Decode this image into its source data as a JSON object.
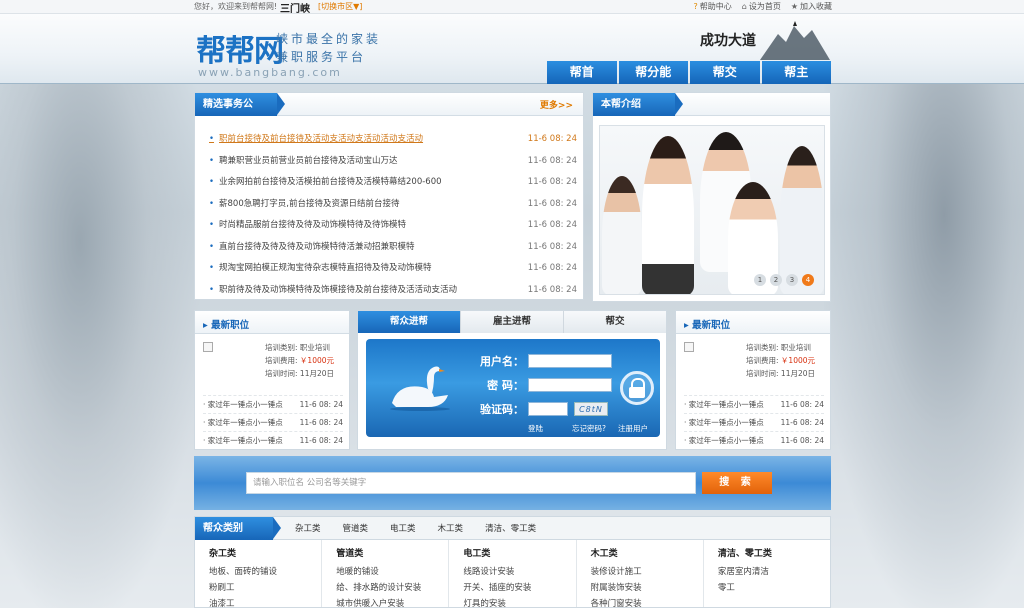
{
  "topbar": {
    "welcome": "您好，欢迎来到帮帮网!",
    "city": "三门峡",
    "switch_city": "[切换市区▼]",
    "links": [
      {
        "icon": "help-icon",
        "label": "帮助中心"
      },
      {
        "icon": "home-icon",
        "label": "设为首页"
      },
      {
        "icon": "star-icon",
        "label": "加入收藏"
      }
    ]
  },
  "header": {
    "logo": "帮帮网",
    "slogan_line1": "峡市最全的家装",
    "slogan_line2": "兼职服务平台",
    "domain": "www.bangbang.com",
    "motto": "成功大道",
    "nav": [
      "帮首",
      "帮分能",
      "帮交",
      "帮主"
    ]
  },
  "featured": {
    "title": "精选事务公",
    "more": "更多>>",
    "items": [
      {
        "text": "职前台接待及前台接待及活动支活动支活动活动支活动",
        "date": "11-6 08: 24"
      },
      {
        "text": "聘兼职营业员前营业员前台接待及活动宝山万达",
        "date": "11-6 08: 24"
      },
      {
        "text": "业余网拍前台接待及活模拍前台接待及活模特幕结200-600",
        "date": "11-6 08: 24"
      },
      {
        "text": "薪800急聘打字员,前台接待及资源日结前台接待",
        "date": "11-6 08: 24"
      },
      {
        "text": "时尚精品服前台接待及待及动饰模特待及待饰模特",
        "date": "11-6 08: 24"
      },
      {
        "text": "直前台接待及待及待及动饰模特待活兼动招兼职模特",
        "date": "11-6 08: 24"
      },
      {
        "text": "规淘宝网拍模正规淘宝待杂志模特直招待及待及动饰模特",
        "date": "11-6 08: 24"
      },
      {
        "text": "职前待及待及动饰模特待及饰模接待及前台接待及活活动支活动",
        "date": "11-6 08: 24"
      }
    ]
  },
  "intro": {
    "title": "本帮介绍",
    "pages": [
      "1",
      "2",
      "3",
      "4"
    ]
  },
  "job_left": {
    "title": "最新职位",
    "category_label": "培训类别:",
    "category_value": "职业培训",
    "fee_label": "培训费用:",
    "fee_value": "￥1000元",
    "time_label": "培训时间:",
    "time_value": "11月20日",
    "items": [
      {
        "text": "家过年一锤点小一锤点",
        "date": "11-6 08: 24"
      },
      {
        "text": "家过年一锤点小一锤点",
        "date": "11-6 08: 24"
      },
      {
        "text": "家过年一锤点小一锤点",
        "date": "11-6 08: 24"
      }
    ]
  },
  "job_right": {
    "title": "最新职位",
    "category_label": "培训类别:",
    "category_value": "职业培训",
    "fee_label": "培训费用:",
    "fee_value": "￥1000元",
    "time_label": "培训时间:",
    "time_value": "11月20日",
    "items": [
      {
        "text": "家过年一锤点小一锤点",
        "date": "11-6 08: 24"
      },
      {
        "text": "家过年一锤点小一锤点",
        "date": "11-6 08: 24"
      },
      {
        "text": "家过年一锤点小一锤点",
        "date": "11-6 08: 24"
      }
    ]
  },
  "login": {
    "tabs": [
      "帮众进帮",
      "雇主进帮",
      "帮交"
    ],
    "username_label": "用户名：",
    "password_label": "密 码：",
    "captcha_label": "验证码：",
    "captcha_text": "C8tN",
    "login_link": "登陆",
    "forgot_link": "忘记密码?",
    "register_link": "注册用户"
  },
  "search": {
    "placeholder": "请输入职位名 公司名等关键字",
    "button": "搜 索"
  },
  "categories": {
    "title": "帮众类别",
    "tabs": [
      "杂工类",
      "管道类",
      "电工类",
      "木工类",
      "清洁、零工类"
    ],
    "columns": [
      {
        "heading": "杂工类",
        "items": [
          "地板、面砖的铺设",
          "粉刷工",
          "油漆工"
        ]
      },
      {
        "heading": "管道类",
        "items": [
          "地暖的铺设",
          "给、排水路的设计安装",
          "城市供暖入户安装"
        ]
      },
      {
        "heading": "电工类",
        "items": [
          "线路设计安装",
          "开关、插座的安装",
          "灯具的安装"
        ]
      },
      {
        "heading": "木工类",
        "items": [
          "装修设计施工",
          "附属装饰安装",
          "各种门窗安装"
        ]
      },
      {
        "heading": "清洁、零工类",
        "items": [
          "家居室内清洁",
          "零工"
        ]
      }
    ]
  },
  "colors": {
    "primary": "#1c72c4",
    "accent": "#e07a00",
    "price": "#d7300f"
  }
}
